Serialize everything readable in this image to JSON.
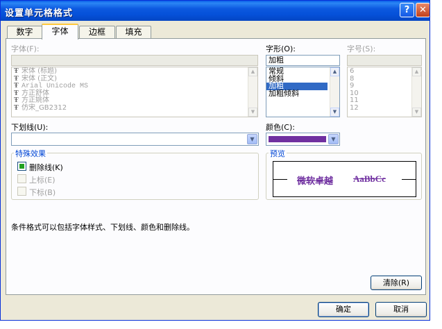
{
  "window": {
    "title": "设置单元格格式"
  },
  "titlebar": {
    "help_glyph": "?",
    "close_glyph": "✕"
  },
  "tabs": [
    {
      "label": "数字",
      "active": false
    },
    {
      "label": "字体",
      "active": true
    },
    {
      "label": "边框",
      "active": false
    },
    {
      "label": "填充",
      "active": false
    }
  ],
  "font": {
    "label": "字体(F):",
    "value": "",
    "items": [
      "宋体 (标题)",
      "宋体 (正文)",
      "Arial Unicode MS",
      "方正舒体",
      "方正姚体",
      "仿宋_GB2312"
    ],
    "item_icon": "truetype-icon"
  },
  "style": {
    "label": "字形(O):",
    "value": "加粗",
    "items": [
      "常规",
      "倾斜",
      "加粗",
      "加粗倾斜"
    ],
    "selected_index": 2
  },
  "size": {
    "label": "字号(S):",
    "value": "",
    "items": [
      "6",
      "8",
      "9",
      "10",
      "11",
      "12"
    ]
  },
  "underline": {
    "label": "下划线(U):",
    "value": ""
  },
  "color": {
    "label": "颜色(C):",
    "value": "#7030a0"
  },
  "effects": {
    "title": "特殊效果",
    "strikethrough": {
      "label": "删除线(K)",
      "checked": true,
      "enabled": true
    },
    "superscript": {
      "label": "上标(E)",
      "checked": false,
      "enabled": false
    },
    "subscript": {
      "label": "下标(B)",
      "checked": false,
      "enabled": false
    }
  },
  "preview": {
    "title": "预览",
    "sample_cjk": "微软卓越",
    "sample_latin": "AaBbCc",
    "text_color": "#7030a0"
  },
  "note": "条件格式可以包括字体样式、下划线、颜色和删除线。",
  "buttons": {
    "clear": "清除(R)",
    "ok": "确定",
    "cancel": "取消"
  },
  "icons": {
    "scroll_up": "▲",
    "scroll_down": "▼",
    "dropdown": "▼"
  }
}
